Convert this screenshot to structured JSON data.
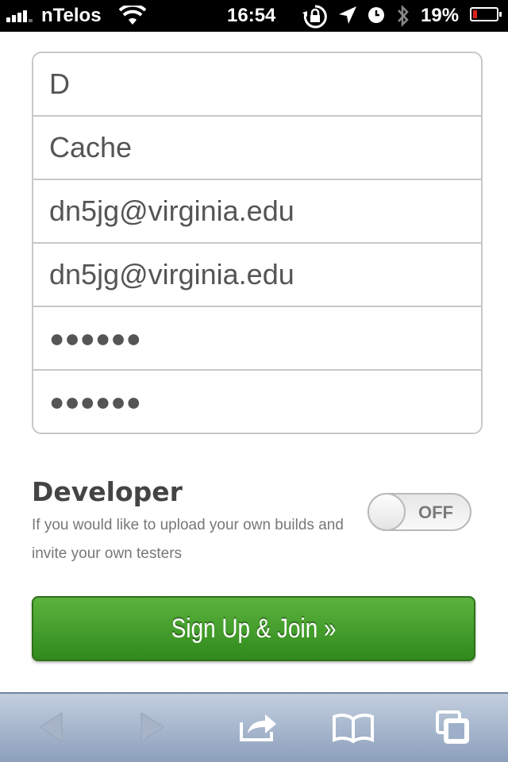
{
  "status_bar": {
    "carrier": "nTelos",
    "time": "16:54",
    "battery_percent": "19%",
    "battery_level": 0.19,
    "signal_bars": 4
  },
  "form": {
    "first_name": "D",
    "last_name": "Cache",
    "email": "dn5jg@virginia.edu",
    "email_confirm": "dn5jg@virginia.edu",
    "password": "●●●●●●",
    "password_confirm": "●●●●●●"
  },
  "developer": {
    "title": "Developer",
    "description": "If you would like to upload your own builds and invite your own testers",
    "toggle_label": "OFF",
    "toggle_state": false
  },
  "signup_button_label": "Sign Up & Join »",
  "toolbar": {
    "icons": [
      "back-arrow-icon",
      "forward-arrow-icon",
      "share-icon",
      "bookmarks-icon",
      "tabs-icon"
    ]
  },
  "colors": {
    "button_green": "#3e9a27",
    "battery_red": "#e0201b",
    "toolbar_blue": "#a9b8cf"
  }
}
